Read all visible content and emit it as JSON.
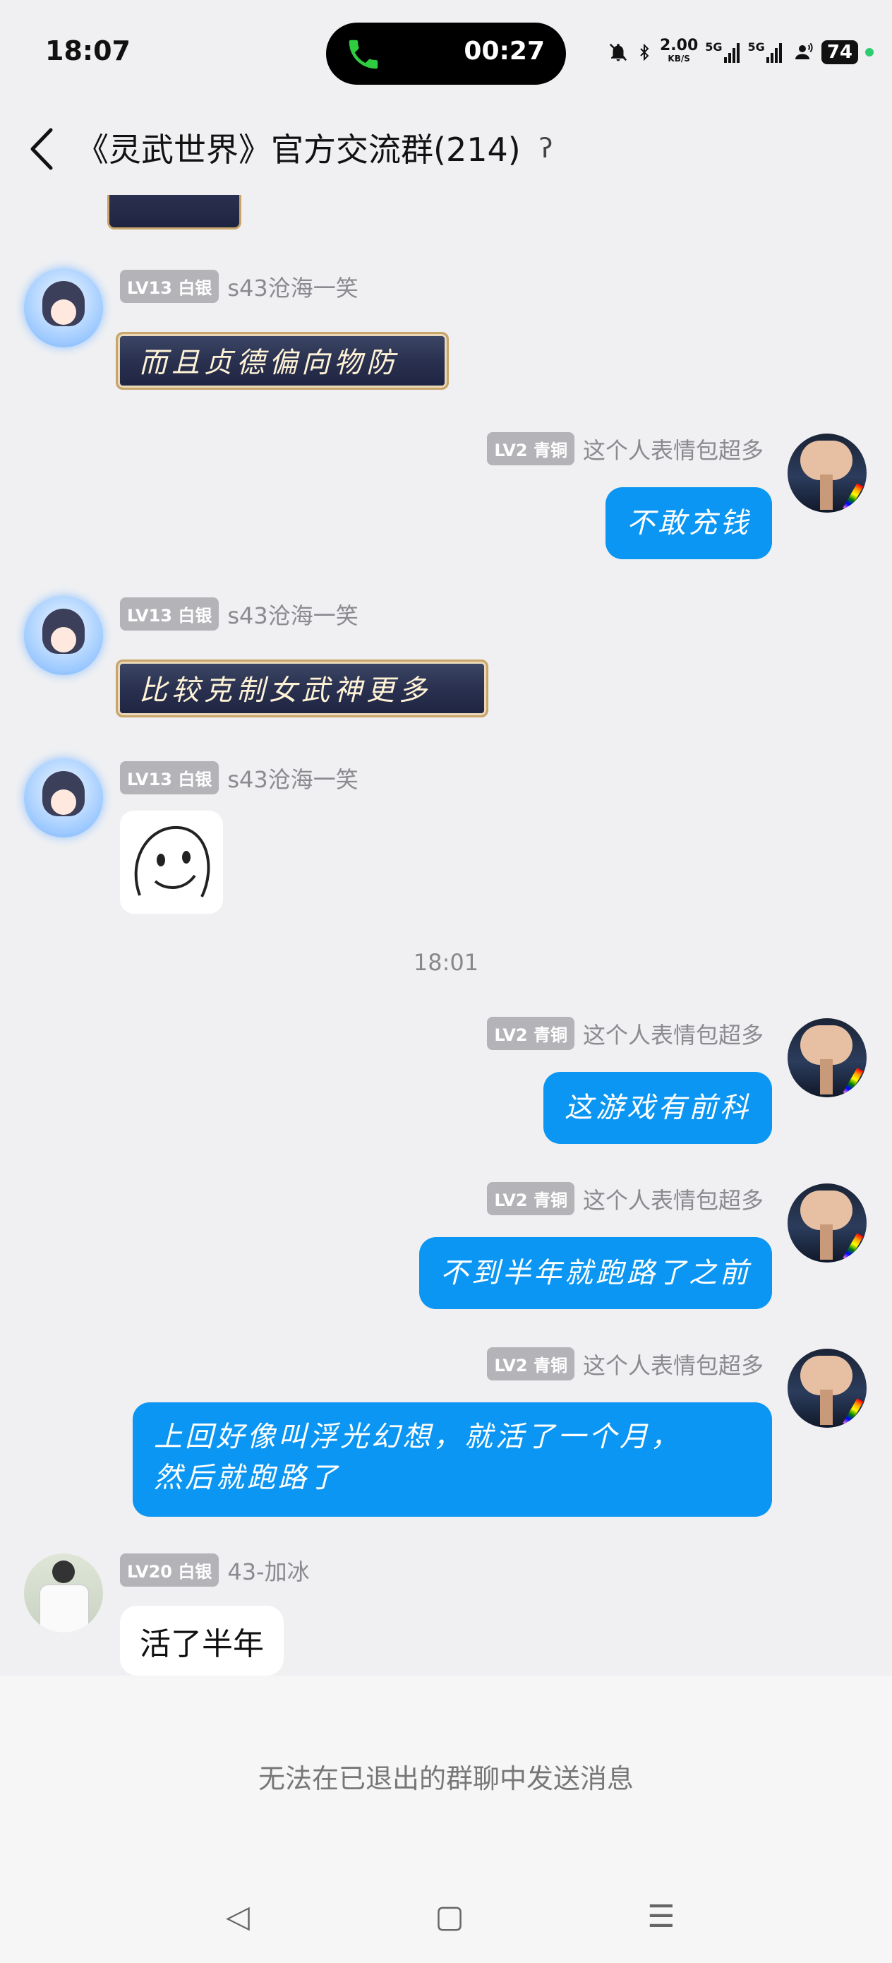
{
  "status_bar": {
    "time": "18:07",
    "call_duration": "00:27",
    "speed_value": "2.00",
    "speed_unit": "KB/S",
    "network_1": "5G",
    "network_2": "5G",
    "battery": "74",
    "icons": [
      "mute-bell-icon",
      "bluetooth-icon",
      "signal-icon",
      "signal-icon",
      "headset-icon",
      "battery-icon"
    ]
  },
  "header": {
    "title": "《灵武世界》官方交流群(214)",
    "back_icon": "back-chevron-icon",
    "ear_icon": "ear-icon"
  },
  "messages": [
    {
      "side": "left",
      "badge": "LV13 白银",
      "name": "s43沧海一笑",
      "type": "sticker",
      "text": "而且贞德偏向物防",
      "avatar": "anime-avatar"
    },
    {
      "side": "right",
      "badge": "LV2 青铜",
      "name": "这个人表情包超多",
      "type": "text",
      "text": "不敢充钱",
      "avatar": "cloud-avatar"
    },
    {
      "side": "left",
      "badge": "LV13 白银",
      "name": "s43沧海一笑",
      "type": "sticker",
      "text": "比较克制女武神更多",
      "avatar": "anime-avatar"
    },
    {
      "side": "left",
      "badge": "LV13 白银",
      "name": "s43沧海一笑",
      "type": "emoji",
      "avatar": "anime-avatar"
    },
    {
      "side": "right",
      "badge": "LV2 青铜",
      "name": "这个人表情包超多",
      "type": "text",
      "text": "这游戏有前科",
      "avatar": "cloud-avatar"
    },
    {
      "side": "right",
      "badge": "LV2 青铜",
      "name": "这个人表情包超多",
      "type": "text",
      "text": "不到半年就跑路了之前",
      "avatar": "cloud-avatar"
    },
    {
      "side": "right",
      "badge": "LV2 青铜",
      "name": "这个人表情包超多",
      "type": "text",
      "text_line1": "上回好像叫浮光幻想，就活了一个月，",
      "text_line2": "然后就跑路了",
      "avatar": "cloud-avatar"
    },
    {
      "side": "left",
      "badge": "LV20 白银",
      "name": "43-加冰",
      "type": "text",
      "text": "活了半年",
      "avatar": "shirt-avatar"
    }
  ],
  "timestamp": "18:01",
  "footer": {
    "notice": "无法在已退出的群聊中发送消息"
  },
  "nav_bar": {
    "back": "◁",
    "home": "▢",
    "menu": "☰"
  }
}
